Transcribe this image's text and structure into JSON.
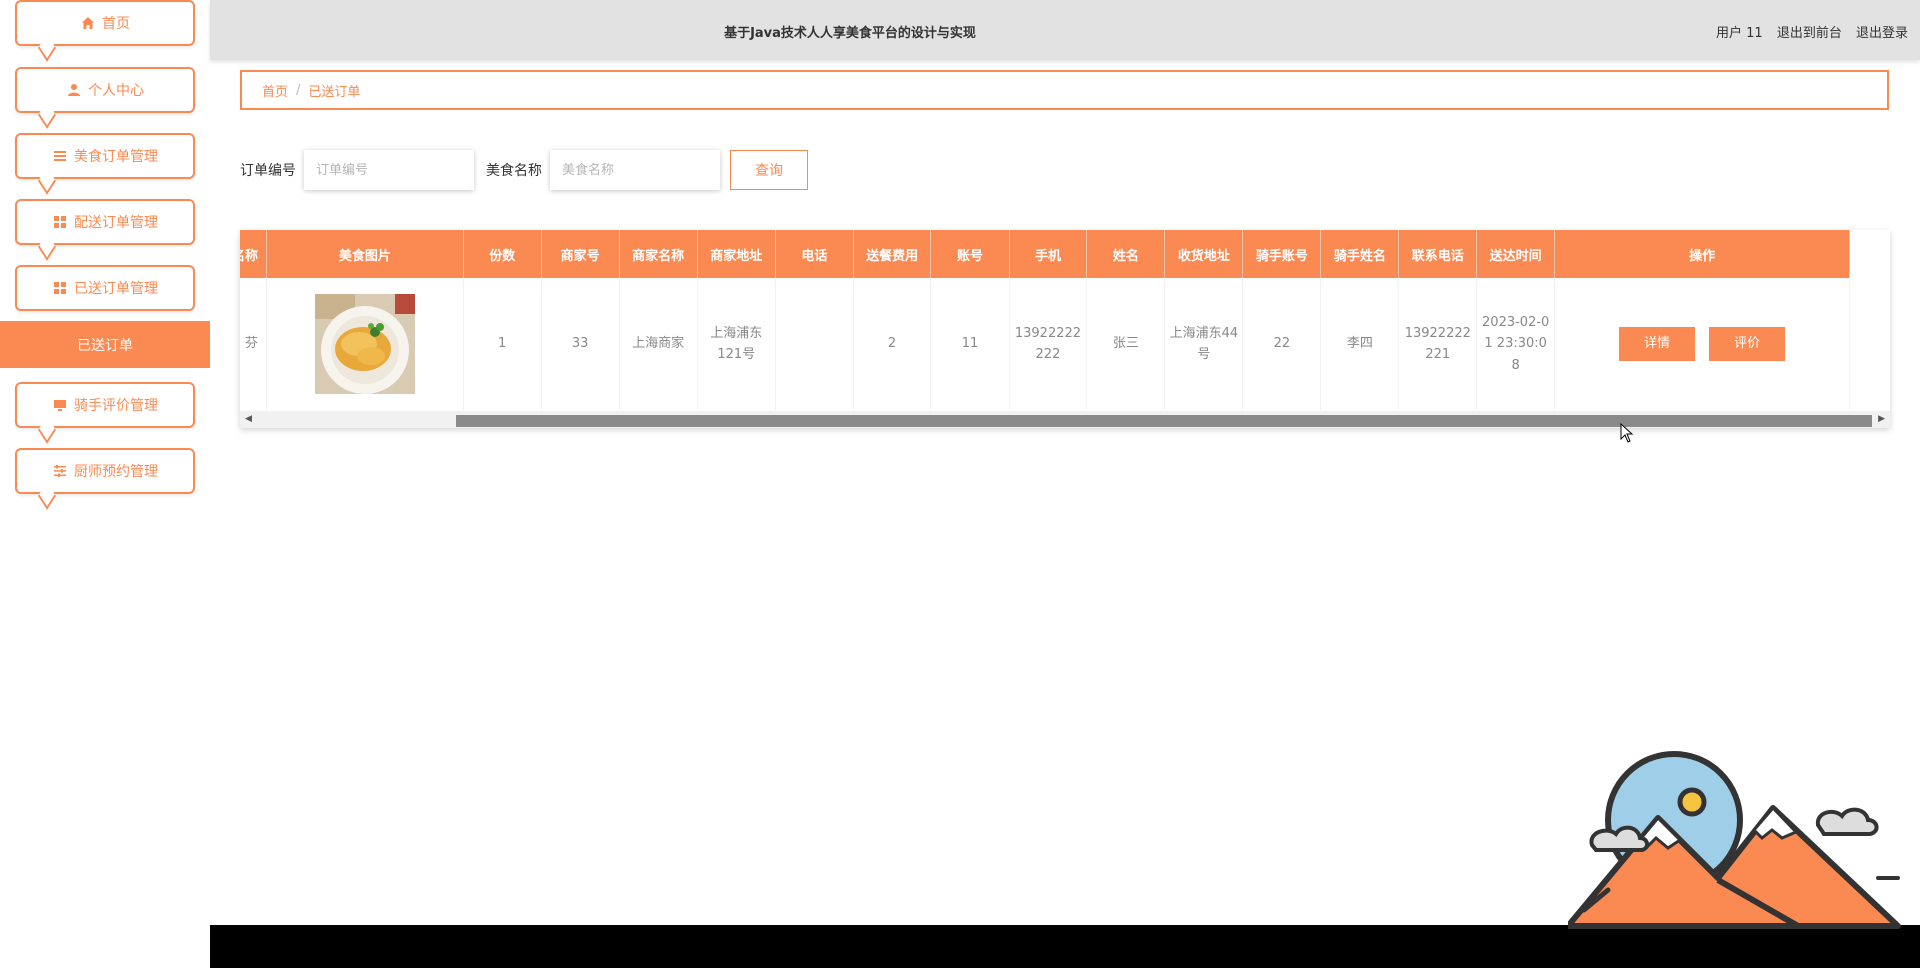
{
  "header": {
    "title": "基于Java技术人人享美食平台的设计与实现",
    "user": "用户 11",
    "to_front": "退出到前台",
    "logout": "退出登录"
  },
  "sidebar": {
    "items": [
      {
        "label": "首页",
        "icon": "home-icon"
      },
      {
        "label": "个人中心",
        "icon": "user-icon"
      },
      {
        "label": "美食订单管理",
        "icon": "list-icon"
      },
      {
        "label": "配送订单管理",
        "icon": "grid-icon"
      },
      {
        "label": "已送订单管理",
        "icon": "grid-icon"
      },
      {
        "label": "骑手评价管理",
        "icon": "monitor-icon"
      },
      {
        "label": "厨师预约管理",
        "icon": "sliders-icon"
      }
    ],
    "active_sub": "已送订单"
  },
  "breadcrumb": {
    "home": "首页",
    "separator": "/",
    "current": "已送订单"
  },
  "search": {
    "order_label": "订单编号",
    "order_placeholder": "订单编号",
    "food_label": "美食名称",
    "food_placeholder": "美食名称",
    "button": "查询"
  },
  "table": {
    "headers": [
      "名称",
      "美食图片",
      "份数",
      "商家号",
      "商家名称",
      "商家地址",
      "电话",
      "送餐费用",
      "账号",
      "手机",
      "姓名",
      "收货地址",
      "骑手账号",
      "骑手姓名",
      "联系电话",
      "送达时间",
      "操作"
    ],
    "rows": [
      {
        "name": "芬",
        "qty": "1",
        "merchant_no": "33",
        "merchant_name": "上海商家",
        "merchant_addr": "上海浦东121号",
        "phone": "",
        "fee": "2",
        "account": "11",
        "mobile": "13922222222",
        "person": "张三",
        "address": "上海浦东44号",
        "rider_account": "22",
        "rider_name": "李四",
        "contact": "13922222221",
        "time": "2023-02-01 23:30:08",
        "detail_btn": "详情",
        "review_btn": "评价"
      }
    ]
  },
  "colors": {
    "accent": "#fa8a52",
    "header_bg": "#e2e2e2"
  }
}
